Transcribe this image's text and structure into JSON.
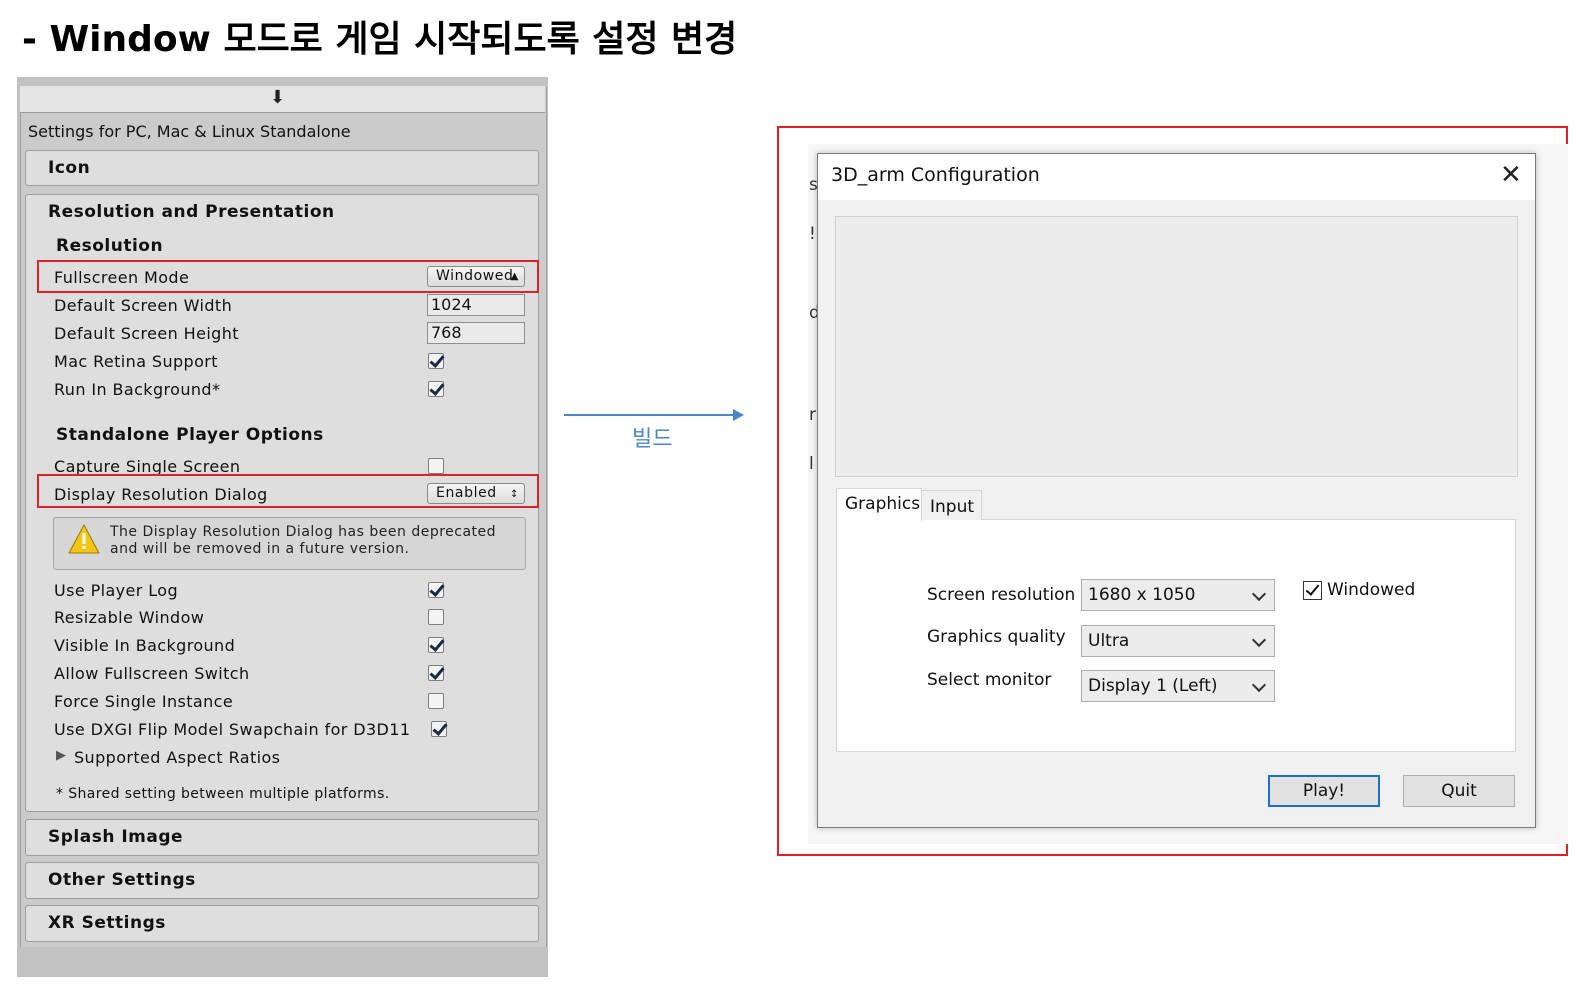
{
  "slide": {
    "title": "- Window 모드로 게임 시작되도록 설정 변경",
    "build_label": "빌드"
  },
  "inspector": {
    "settings_for": "Settings for PC, Mac & Linux Standalone",
    "sections": {
      "icon": "Icon",
      "resolution_presentation": "Resolution and Presentation",
      "splash": "Splash Image",
      "other": "Other Settings",
      "xr": "XR Settings"
    },
    "resolution": {
      "heading": "Resolution",
      "fullscreen_mode_label": "Fullscreen Mode",
      "fullscreen_mode_value": "Windowed",
      "width_label": "Default Screen Width",
      "width_value": "1024",
      "height_label": "Default Screen Height",
      "height_value": "768",
      "retina_label": "Mac Retina Support",
      "retina_checked": true,
      "background_label": "Run In Background*",
      "background_checked": true
    },
    "standalone": {
      "heading": "Standalone Player Options",
      "capture_label": "Capture Single Screen",
      "capture_checked": false,
      "dialog_label": "Display Resolution Dialog",
      "dialog_value": "Enabled",
      "warning_line1": "The Display Resolution Dialog has been deprecated",
      "warning_line2": "and will be removed in a future version.",
      "player_log_label": "Use Player Log",
      "player_log_checked": true,
      "resizable_label": "Resizable Window",
      "resizable_checked": false,
      "visible_bg_label": "Visible In Background",
      "visible_bg_checked": true,
      "allow_fs_label": "Allow Fullscreen Switch",
      "allow_fs_checked": true,
      "single_instance_label": "Force Single Instance",
      "single_instance_checked": false,
      "dxgi_label": "Use DXGI Flip Model Swapchain for D3D11",
      "dxgi_checked": true,
      "aspect_label": "Supported Aspect Ratios",
      "note": "* Shared setting between multiple platforms."
    }
  },
  "config_dialog": {
    "title": "3D_arm Configuration",
    "tabs": [
      "Graphics",
      "Input"
    ],
    "screen_resolution_label": "Screen resolution",
    "screen_resolution_value": "1680 x 1050",
    "graphics_quality_label": "Graphics quality",
    "graphics_quality_value": "Ultra",
    "select_monitor_label": "Select monitor",
    "select_monitor_value": "Display 1 (Left)",
    "windowed_label": "Windowed",
    "windowed_checked": true,
    "play_button": "Play!",
    "quit_button": "Quit"
  },
  "colors": {
    "highlight": "#e0202a",
    "arrow": "#4a86c8"
  }
}
